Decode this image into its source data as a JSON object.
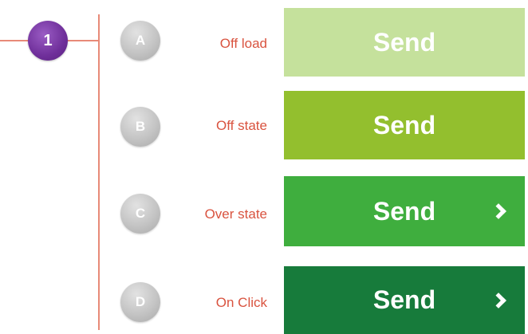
{
  "step": {
    "number": "1",
    "color": "#6f2f9a"
  },
  "connector_color": "#e88a78",
  "label_color": "#d9533f",
  "states": [
    {
      "letter": "A",
      "label": "Off load",
      "button_label": "Send",
      "button_color": "#c5e19c",
      "chevron": false
    },
    {
      "letter": "B",
      "label": "Off state",
      "button_label": "Send",
      "button_color": "#93bf2e",
      "chevron": false
    },
    {
      "letter": "C",
      "label": "Over state",
      "button_label": "Send",
      "button_color": "#3fae3e",
      "chevron": true,
      "chevron_icon": "chevron-right-icon"
    },
    {
      "letter": "D",
      "label": "On Click",
      "button_label": "Send",
      "button_color": "#177b3b",
      "chevron": true,
      "chevron_icon": "chevron-right-icon"
    }
  ]
}
